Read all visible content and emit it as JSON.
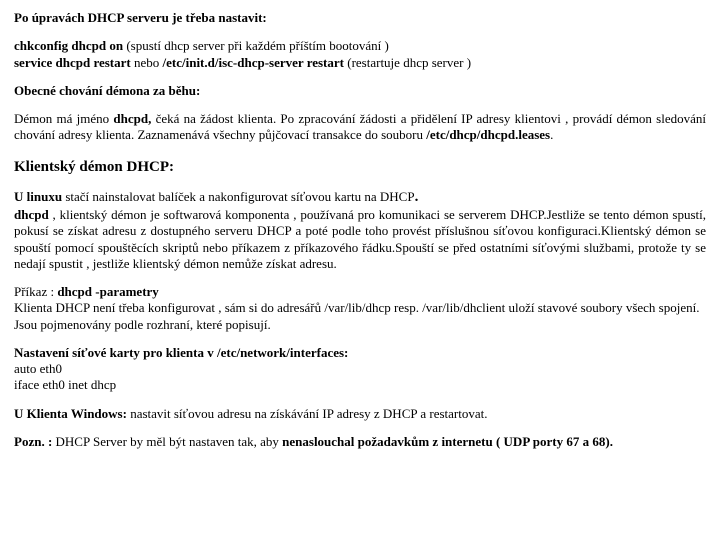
{
  "h1": "Po úpravách DHCP serveru je třeba nastavit:",
  "line_chk_b": "chkconfig  dhcpd on",
  "line_chk_r": "  (spustí dhcp server při každém příštím bootování )",
  "line_svc_b1": "service dhcpd restart",
  "line_svc_r1": "  nebo ",
  "line_svc_b2": "/etc/init.d/isc-dhcp-server restart",
  "line_svc_r2": "   (restartuje dhcp server )",
  "h2": "Obecné chování démona za běhu:",
  "daemon_p_a": "Démon má jméno ",
  "daemon_p_b": "dhcpd,",
  "daemon_p_c": " čeká na žádost klienta. Po zpracování žádosti a přidělení IP adresy klientovi , provádí démon sledování chování adresy klienta. Zaznamenává všechny půjčovací transakce do souboru ",
  "daemon_p_d": "/etc/dhcp/dhcpd.leases",
  "h3": "Klientský démon DHCP:",
  "linux_a": "U linuxu",
  "linux_b": " stačí nainstalovat balíček a nakonfigurovat síťovou kartu na DHCP",
  "linux_period": ".",
  "client_p_a": "dhcpd",
  "client_p_b": " , klientský démon je softwarová komponenta , používaná pro komunikaci se serverem DHCP.Jestliže se tento démon spustí, pokusí se získat adresu z dostupného serveru DHCP a poté podle toho provést příslušnou síťovou konfiguraci.Klientský démon se spouští pomocí spouštěcích skriptů nebo příkazem z příkazového řádku.Spouští se před ostatními síťovými službami, protože ty se nedají spustit , jestliže klientský démon nemůže získat adresu.",
  "prikaz_a": "Příkaz : ",
  "prikaz_b": "dhcpd -parametry",
  "klienta_line": "Klienta DHCP není třeba konfigurovat , sám si do adresářů  /var/lib/dhcp resp. /var/lib/dhclient uloží stavové soubory všech spojení. Jsou pojmenovány podle rozhraní, které popisují.",
  "nast_h": "Nastavení síťové karty pro klienta v /etc/network/interfaces:",
  "nast_l1": "auto eth0",
  "nast_l2": "iface eth0 inet dhcp",
  "win_a": "U  Klienta Windows:",
  "win_b": " nastavit síťovou adresu na získávání IP adresy z DHCP a restartovat.",
  "pozn_a": "Pozn. :",
  "pozn_b": " DHCP Server by měl být nastaven tak, aby ",
  "pozn_c": "nenaslouchal požadavkům z internetu ( UDP porty 67 a 68)."
}
